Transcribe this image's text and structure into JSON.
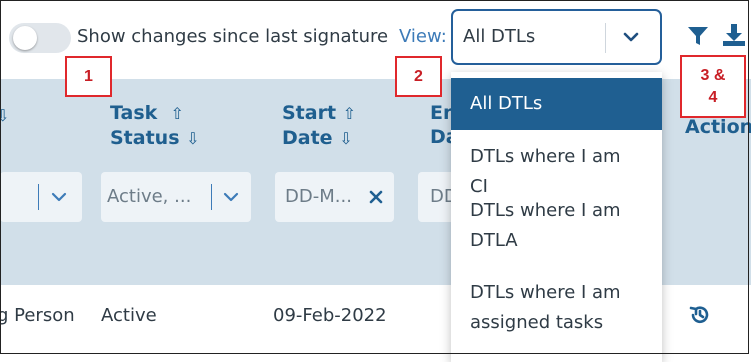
{
  "toolbar": {
    "toggle_label": "Show changes since last signature",
    "toggle_on": false,
    "view_label": "View:",
    "view_selected": "All DTLs",
    "icons": [
      "toggle",
      "chevron-down-icon",
      "filter-icon",
      "download-icon"
    ]
  },
  "table": {
    "headers": {
      "first_partial": "",
      "task_status_line1": "Task",
      "task_status_line2": "Status",
      "start_date_line1": "Start",
      "start_date_line2": "Date",
      "end_date_line1": "En",
      "end_date_line2": "Da",
      "action": "Action"
    },
    "filters": {
      "first_value": "",
      "task_status_value": "Active, ...",
      "start_date_placeholder": "DD-M...",
      "end_date_placeholder": "DD"
    },
    "rows": [
      {
        "person": "g Person",
        "status": "Active",
        "start_date": "09-Feb-2022"
      }
    ]
  },
  "view_menu": {
    "options": [
      {
        "label": "All DTLs",
        "selected": true
      },
      {
        "label_line1": "DTLs where I am CI"
      },
      {
        "label_line1": "DTLs where I am",
        "label_line2": "DTLA"
      },
      {
        "label_line1": "DTLs where I am",
        "label_line2": "assigned tasks"
      }
    ]
  },
  "annotations": {
    "c1": "1",
    "c2": "2",
    "c3_line1": "3 &",
    "c3_line2": "4"
  },
  "colors": {
    "accent": "#1f5f91",
    "header_bg": "#d1dfe9",
    "callout": "#e0282c"
  }
}
